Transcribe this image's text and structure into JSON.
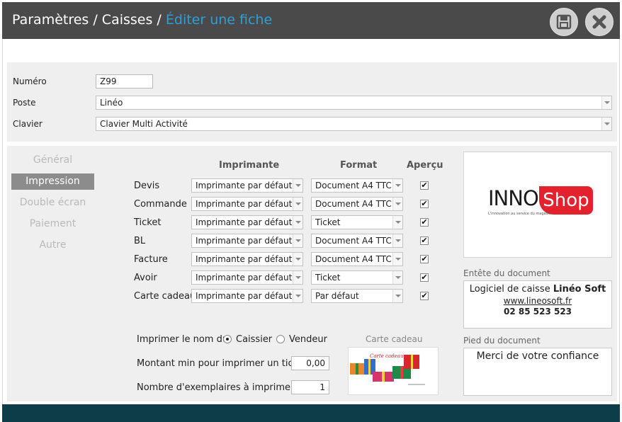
{
  "titlebar": {
    "path": "Paramètres / Caisses / ",
    "current": "Éditer une fiche",
    "save_icon": "floppy-disk-icon",
    "close_icon": "close-x-icon"
  },
  "header_form": {
    "numero_label": "Numéro",
    "numero_value": "Z99",
    "poste_label": "Poste",
    "poste_value": "Linéo",
    "clavier_label": "Clavier",
    "clavier_value": "Clavier Multi Activité"
  },
  "tabs": [
    "Général",
    "Impression",
    "Double écran",
    "Paiement",
    "Autre"
  ],
  "active_tab": "Impression",
  "print_table": {
    "headers": {
      "printer": "Imprimante",
      "format": "Format",
      "preview": "Aperçu"
    },
    "rows": [
      {
        "label": "Devis",
        "printer": "Imprimante par défaut",
        "format": "Document A4 TTC",
        "preview": true
      },
      {
        "label": "Commande",
        "printer": "Imprimante par défaut",
        "format": "Document A4 TTC",
        "preview": true
      },
      {
        "label": "Ticket",
        "printer": "Imprimante par défaut",
        "format": "Ticket",
        "preview": true
      },
      {
        "label": "BL",
        "printer": "Imprimante par défaut",
        "format": "Document A4 TTC",
        "preview": true
      },
      {
        "label": "Facture",
        "printer": "Imprimante par défaut",
        "format": "Document A4 TTC",
        "preview": true
      },
      {
        "label": "Avoir",
        "printer": "Imprimante par défaut",
        "format": "Ticket",
        "preview": true
      },
      {
        "label": "Carte cadeau",
        "printer": "Imprimante par défaut",
        "format": "Par défaut",
        "preview": true
      }
    ]
  },
  "print_name": {
    "label": "Imprimer le nom du",
    "option1": "Caissier",
    "option2": "Vendeur",
    "selected": "Caissier"
  },
  "min_amount": {
    "label": "Montant min pour imprimer un ticket",
    "value": "0,00"
  },
  "copies": {
    "label": "Nombre d'exemplaires à imprimer",
    "value": "1"
  },
  "gift_card": {
    "label": "Carte cadeau",
    "image_text": "Carte cadeau"
  },
  "logo": {
    "part1": "INNO",
    "part2": "Shop",
    "tagline": "L'innovation au service du magasin"
  },
  "document_header": {
    "label": "Entête du document",
    "line1_prefix": "Logiciel de caisse ",
    "line1_bold": "Linéo Soft",
    "line2": "www.lineosoft.fr",
    "line3": "02 85 523 523"
  },
  "document_footer": {
    "label": "Pied du document",
    "text": "Merci de votre confiance"
  },
  "colors": {
    "titlebar": "#4a4a4a",
    "title_accent": "#2f9ed8",
    "footer_bar": "#0e3d4a",
    "active_tab": "#8c8c8c",
    "logo_red": "#e3222d"
  }
}
